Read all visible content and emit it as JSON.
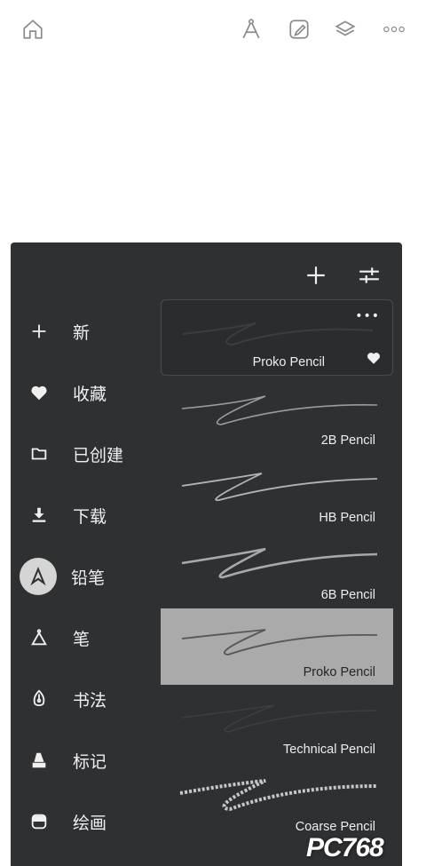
{
  "toolbar": {
    "icons": [
      "home-icon",
      "compass-icon",
      "edit-icon",
      "layers-icon",
      "more-icon"
    ]
  },
  "panel": {
    "actions": [
      "add-icon",
      "adjust-icon"
    ],
    "sidebar": [
      {
        "label": "新",
        "icon": "plus-icon"
      },
      {
        "label": "收藏",
        "icon": "heart-icon"
      },
      {
        "label": "已创建",
        "icon": "folder-icon"
      },
      {
        "label": "下载",
        "icon": "download-icon"
      },
      {
        "label": "铅笔",
        "icon": "pencil-tip-icon",
        "active": true
      },
      {
        "label": "笔",
        "icon": "pen-icon"
      },
      {
        "label": "书法",
        "icon": "nib-icon"
      },
      {
        "label": "标记",
        "icon": "marker-icon"
      },
      {
        "label": "绘画",
        "icon": "paint-icon"
      }
    ],
    "brushes": [
      {
        "name": "Proko Pencil",
        "selected": true,
        "more": "•••",
        "favorite": true
      },
      {
        "name": "2B Pencil"
      },
      {
        "name": "HB Pencil"
      },
      {
        "name": "6B Pencil"
      },
      {
        "name": "Proko Pencil",
        "highlighted": true
      },
      {
        "name": "Technical Pencil"
      },
      {
        "name": "Coarse Pencil"
      }
    ]
  },
  "watermark": {
    "text": "PC768"
  },
  "colors": {
    "panel": "#2f3032",
    "highlight": "#aaaaaa",
    "text": "#f0f0f0"
  }
}
